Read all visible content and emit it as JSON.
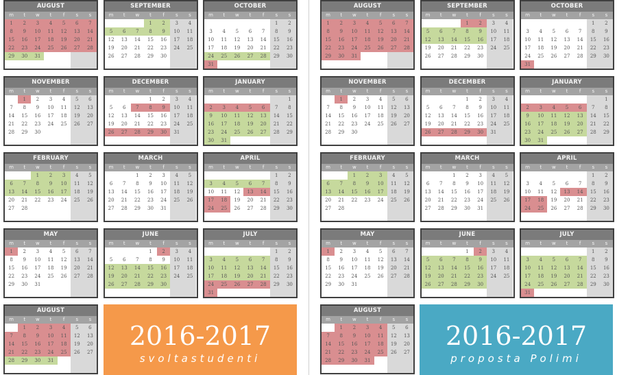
{
  "weekdays": [
    "m",
    "t",
    "w",
    "t",
    "f",
    "s",
    "s"
  ],
  "colors": {
    "header": "#7b7b7b",
    "weekday_row": "#a3a3a3",
    "weekend": "#d9d9d9",
    "red": "#d98e90",
    "green": "#c6d99d",
    "banner_left": "#f5994a",
    "banner_right": "#4aa9c4"
  },
  "calendars": [
    {
      "banner": {
        "title": "2016-2017",
        "subtitle": "svoltastudenti",
        "color": "#f5994a"
      },
      "months": [
        {
          "name": "AUGUST",
          "red": [
            1,
            2,
            3,
            4,
            5,
            6,
            7,
            8,
            9,
            10,
            11,
            12,
            13,
            14,
            15,
            16,
            17,
            18,
            19,
            20,
            21,
            22,
            23,
            24,
            25,
            26,
            27,
            28
          ],
          "green": [
            29,
            30,
            31
          ]
        },
        {
          "name": "SEPTEMBER",
          "red": [],
          "green": [
            1,
            2,
            5,
            6,
            7,
            8,
            9
          ]
        },
        {
          "name": "OCTOBER",
          "red": [
            31
          ],
          "green": [
            24,
            25,
            26,
            27,
            28
          ]
        },
        {
          "name": "NOVEMBER",
          "red": [
            1
          ],
          "green": []
        },
        {
          "name": "DECEMBER",
          "red": [
            7,
            8,
            9,
            26,
            27,
            28,
            29,
            30
          ],
          "green": []
        },
        {
          "name": "JANUARY",
          "red": [
            2,
            3,
            4,
            5,
            6
          ],
          "green": [
            9,
            10,
            11,
            12,
            13,
            16,
            17,
            18,
            19,
            20,
            23,
            24,
            25,
            26,
            27,
            30,
            31
          ]
        },
        {
          "name": "FEBRUARY",
          "red": [],
          "green": [
            1,
            2,
            3,
            6,
            7,
            8,
            9,
            10,
            13,
            14,
            15,
            16,
            17
          ]
        },
        {
          "name": "MARCH",
          "red": [],
          "green": []
        },
        {
          "name": "APRIL",
          "red": [
            13,
            14,
            17,
            18,
            24,
            25
          ],
          "green": [
            3,
            4,
            5,
            6,
            7
          ]
        },
        {
          "name": "MAY",
          "red": [
            1
          ],
          "green": []
        },
        {
          "name": "JUNE",
          "red": [
            2
          ],
          "green": [
            12,
            13,
            14,
            15,
            16,
            19,
            20,
            21,
            22,
            23,
            26,
            27,
            28,
            29,
            30
          ]
        },
        {
          "name": "JULY",
          "red": [
            24,
            25,
            26,
            27,
            28,
            31
          ],
          "green": [
            3,
            4,
            5,
            6,
            7,
            10,
            11,
            12,
            13,
            14,
            17,
            18,
            19,
            20,
            21
          ]
        },
        {
          "name": "AUGUST",
          "red": [
            1,
            2,
            3,
            4,
            7,
            8,
            9,
            10,
            11,
            14,
            15,
            16,
            17,
            18,
            21,
            22,
            23,
            24,
            25
          ],
          "green": [
            28,
            29,
            30,
            31
          ]
        }
      ]
    },
    {
      "banner": {
        "title": "2016-2017",
        "subtitle": "proposta Polimi",
        "color": "#4aa9c4"
      },
      "months": [
        {
          "name": "AUGUST",
          "red": [
            1,
            2,
            3,
            4,
            5,
            6,
            7,
            8,
            9,
            10,
            11,
            12,
            13,
            14,
            15,
            16,
            17,
            18,
            19,
            20,
            21,
            22,
            23,
            24,
            25,
            26,
            27,
            28,
            29,
            30,
            31
          ],
          "green": []
        },
        {
          "name": "SEPTEMBER",
          "red": [
            1,
            2
          ],
          "green": [
            5,
            6,
            7,
            8,
            9,
            12,
            13,
            14,
            15,
            16
          ]
        },
        {
          "name": "OCTOBER",
          "red": [
            31
          ],
          "green": []
        },
        {
          "name": "NOVEMBER",
          "red": [
            1
          ],
          "green": []
        },
        {
          "name": "DECEMBER",
          "red": [
            26,
            27,
            28,
            29,
            30
          ],
          "green": []
        },
        {
          "name": "JANUARY",
          "red": [
            2,
            3,
            4,
            5,
            6
          ],
          "green": [
            9,
            10,
            11,
            12,
            13,
            16,
            17,
            18,
            19,
            20,
            23,
            24,
            25,
            26,
            27,
            30,
            31
          ]
        },
        {
          "name": "FEBRUARY",
          "red": [],
          "green": [
            1,
            2,
            3,
            6,
            7,
            8,
            9,
            10,
            13,
            14,
            15,
            16,
            17
          ]
        },
        {
          "name": "MARCH",
          "red": [],
          "green": []
        },
        {
          "name": "APRIL",
          "red": [
            13,
            14,
            17,
            18,
            24,
            25
          ],
          "green": []
        },
        {
          "name": "MAY",
          "red": [
            1
          ],
          "green": []
        },
        {
          "name": "JUNE",
          "red": [
            2
          ],
          "green": [
            5,
            6,
            7,
            8,
            9,
            12,
            13,
            14,
            15,
            16,
            19,
            20,
            21,
            22,
            23,
            26,
            27,
            28,
            29,
            30
          ]
        },
        {
          "name": "JULY",
          "red": [
            31
          ],
          "green": [
            3,
            4,
            5,
            6,
            7,
            10,
            11,
            12,
            13,
            14,
            17,
            18,
            19,
            20,
            21,
            24,
            25,
            26,
            27,
            28
          ]
        },
        {
          "name": "AUGUST",
          "red": [
            1,
            2,
            3,
            4,
            7,
            8,
            9,
            10,
            11,
            14,
            15,
            16,
            17,
            18,
            21,
            22,
            23,
            24,
            25,
            28,
            29,
            30,
            31
          ],
          "green": []
        }
      ]
    }
  ]
}
